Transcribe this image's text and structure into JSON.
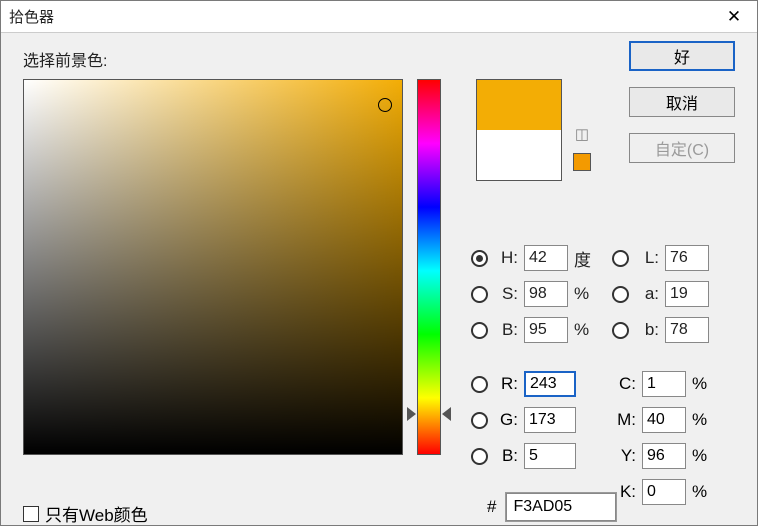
{
  "window": {
    "title": "拾色器"
  },
  "labels": {
    "foreground": "选择前景色:",
    "webOnly": "只有Web颜色"
  },
  "buttons": {
    "ok": "好",
    "cancel": "取消",
    "custom": "自定(C)"
  },
  "color": {
    "current": "#ffffff",
    "new": "#f3ad05",
    "websafe_swatch": "#f39a00",
    "hex": "F3AD05"
  },
  "hsb": {
    "h": {
      "label": "H:",
      "value": "42",
      "unit": "度",
      "selected": true
    },
    "s": {
      "label": "S:",
      "value": "98",
      "unit": "%",
      "selected": false
    },
    "b": {
      "label": "B:",
      "value": "95",
      "unit": "%",
      "selected": false
    }
  },
  "lab": {
    "l": {
      "label": "L:",
      "value": "76",
      "selected": false
    },
    "a": {
      "label": "a:",
      "value": "19",
      "selected": false
    },
    "b": {
      "label": "b:",
      "value": "78",
      "selected": false
    }
  },
  "rgb": {
    "r": {
      "label": "R:",
      "value": "243",
      "selected": false,
      "focused": true
    },
    "g": {
      "label": "G:",
      "value": "173",
      "selected": false
    },
    "b": {
      "label": "B:",
      "value": "5",
      "selected": false
    }
  },
  "cmyk": {
    "c": {
      "label": "C:",
      "value": "1",
      "unit": "%"
    },
    "m": {
      "label": "M:",
      "value": "40",
      "unit": "%"
    },
    "y": {
      "label": "Y:",
      "value": "96",
      "unit": "%"
    },
    "k": {
      "label": "K:",
      "value": "0",
      "unit": "%"
    }
  },
  "hex_label": "#"
}
